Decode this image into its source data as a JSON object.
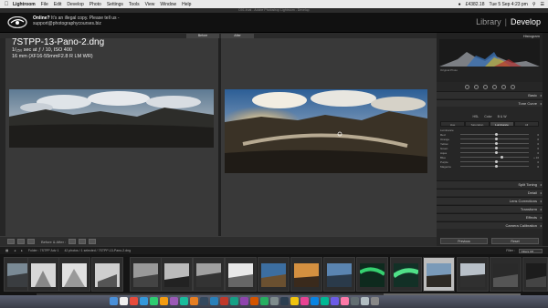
{
  "menubar": {
    "apple_icon": "apple-icon",
    "app_name": "Lightroom",
    "items": [
      "File",
      "Edit",
      "Develop",
      "Photo",
      "Settings",
      "Tools",
      "View",
      "Window",
      "Help"
    ],
    "battery": "£4382.18",
    "clock": "Tue 5 Sep  4:23 pm"
  },
  "window": {
    "title": "D01.lrcat - Adobe Photoshop Lightroom - Develop"
  },
  "notice": {
    "strong": "Online?",
    "text": " It's an illegal copy. Please tell us - support@photographycourses.biz"
  },
  "modules": {
    "library": "Library",
    "separator": "|",
    "develop": "Develop"
  },
  "view": {
    "before_label": "Before",
    "after_label": "After"
  },
  "photo_info": {
    "filename": "7STPP-13-Pano-2.dng",
    "exposure": "1/₂₅₀ sec at ƒ / 10, ISO 400",
    "lens": "16 mm (XF16-55mmF2.8 R LM WR)"
  },
  "toolbar": {
    "mode_label": "Before & After :"
  },
  "right_panel": {
    "histogram_label": "Histogram",
    "original_photo": "Original Photo",
    "sections_top": [
      "Basic",
      "Tone Curve"
    ],
    "hsl_header": [
      "HSL",
      "Color",
      "B & W"
    ],
    "hsl_tabs": [
      "Hue",
      "Saturation",
      "Luminance",
      "All"
    ],
    "hsl_active_tab": "Luminance",
    "hsl_title": "Luminance",
    "hsl_rows": [
      {
        "name": "Red",
        "value": "0"
      },
      {
        "name": "Orange",
        "value": "0"
      },
      {
        "name": "Yellow",
        "value": "0"
      },
      {
        "name": "Green",
        "value": "0"
      },
      {
        "name": "Aqua",
        "value": "0"
      },
      {
        "name": "Blue",
        "value": "+ 16"
      },
      {
        "name": "Purple",
        "value": "0"
      },
      {
        "name": "Magenta",
        "value": "0"
      }
    ],
    "sections_bottom": [
      "Split Toning",
      "Detail",
      "Lens Corrections",
      "Transform",
      "Effects",
      "Camera Calibration"
    ],
    "previous_button": "Previous",
    "reset_button": "Reset"
  },
  "filmstrip_bar": {
    "folder_label": "Folder : 7STPP Adv 1",
    "count": "42 photos / 1 selected / 7STPP-13-Pano-2.dng",
    "filter_label": "Filter :",
    "filter_value": "Filters Off"
  },
  "colors": {
    "accent": "#ffffff",
    "panel": "#262626",
    "selected_cell": "#bdbdbd"
  }
}
